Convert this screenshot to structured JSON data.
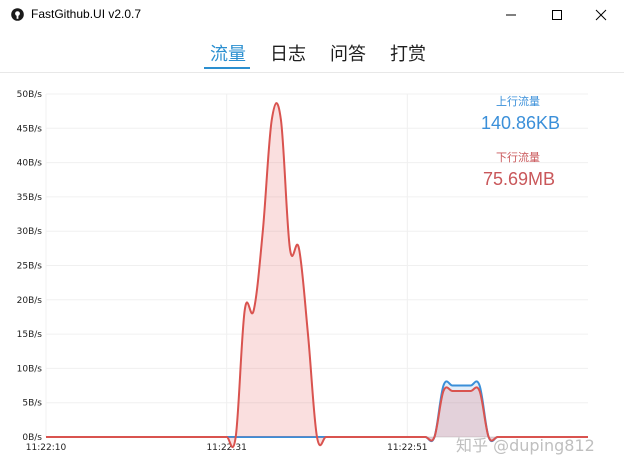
{
  "window": {
    "title": "FastGithub.UI v2.0.7",
    "controls": {
      "minimize": "—",
      "maximize": "☐",
      "close": "✕"
    }
  },
  "tabs": [
    {
      "label": "流量",
      "active": true
    },
    {
      "label": "日志",
      "active": false
    },
    {
      "label": "问答",
      "active": false
    },
    {
      "label": "打赏",
      "active": false
    }
  ],
  "stats": {
    "upload_label": "上行流量",
    "upload_value": "140.86KB",
    "upload_color": "#3a8fd9",
    "download_label": "下行流量",
    "download_value": "75.69MB",
    "download_color": "#c9575a"
  },
  "watermark": "知乎 @duping812",
  "chart_data": {
    "type": "area",
    "ylim": [
      0,
      50
    ],
    "yticks": [
      "0B/s",
      "5B/s",
      "10B/s",
      "15B/s",
      "20B/s",
      "25B/s",
      "30B/s",
      "35B/s",
      "40B/s",
      "45B/s",
      "50B/s"
    ],
    "xticks": [
      "11:22:10",
      "11:22:31",
      "11:22:51"
    ],
    "x": [
      0,
      1,
      2,
      3,
      4,
      5,
      6,
      7,
      8,
      9,
      10,
      11,
      12,
      13,
      14,
      15,
      16,
      17,
      18,
      19,
      20,
      21,
      22,
      23,
      24,
      25,
      26,
      27,
      28,
      29,
      30,
      31,
      32,
      33,
      34,
      35,
      36,
      37,
      38,
      39,
      40,
      41,
      42,
      43,
      44,
      45,
      46,
      47,
      48,
      49,
      50,
      51,
      52,
      53,
      54,
      55,
      56,
      57,
      58,
      59,
      60
    ],
    "series": [
      {
        "color": "#3a8fd9",
        "values": [
          0,
          0,
          0,
          0,
          0,
          0,
          0,
          0,
          0,
          0,
          0,
          0,
          0,
          0,
          0,
          0,
          0,
          0,
          0,
          0,
          0,
          0,
          0,
          0,
          0,
          0,
          0,
          0,
          0,
          0,
          0,
          0,
          0,
          0,
          0,
          0,
          0,
          0,
          0,
          0,
          0,
          0,
          0,
          0,
          7.5,
          7.5,
          7.5,
          7.5,
          7.5,
          0,
          0,
          0,
          0,
          0,
          0,
          0,
          0,
          0,
          0,
          0,
          0
        ]
      },
      {
        "color": "#d9534f",
        "values": [
          0,
          0,
          0,
          0,
          0,
          0,
          0,
          0,
          0,
          0,
          0,
          0,
          0,
          0,
          0,
          0,
          0,
          0,
          0,
          0,
          0,
          0,
          18.5,
          18.5,
          30,
          46.3,
          46.3,
          27.5,
          27.5,
          15,
          0,
          0,
          0,
          0,
          0,
          0,
          0,
          0,
          0,
          0,
          0,
          0,
          0,
          0,
          6.7,
          6.7,
          6.7,
          6.7,
          6.7,
          0,
          0,
          0,
          0,
          0,
          0,
          0,
          0,
          0,
          0,
          0,
          0
        ]
      }
    ]
  }
}
